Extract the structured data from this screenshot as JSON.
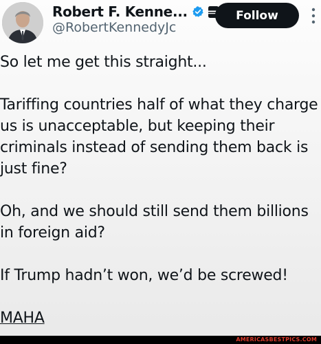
{
  "author": {
    "display_name": "Robert F. Kenne...",
    "handle": "@RobertKennedyJc",
    "avatar_icon": "profile-photo",
    "verified_icon": "verified-badge-icon",
    "affiliate_icon": "affiliation-icon"
  },
  "actions": {
    "follow_label": "Follow",
    "more_icon": "more-options-icon"
  },
  "tweet": {
    "paragraphs": [
      "So let me get this straight...",
      "Tariffing countries half of what they charge us is unacceptable, but keeping their criminals instead of sending them back is just fine?",
      "Oh, and we should still send them billions in foreign aid?",
      "If Trump hadn’t won, we’d be screwed!",
      "MAHA"
    ]
  },
  "watermark": {
    "text": "AMERICASBESTPICS.COM"
  },
  "colors": {
    "verified": "#1d9bf0",
    "follow_bg": "#0f1419",
    "handle": "#536471",
    "watermark_text": "#d93a2b"
  }
}
